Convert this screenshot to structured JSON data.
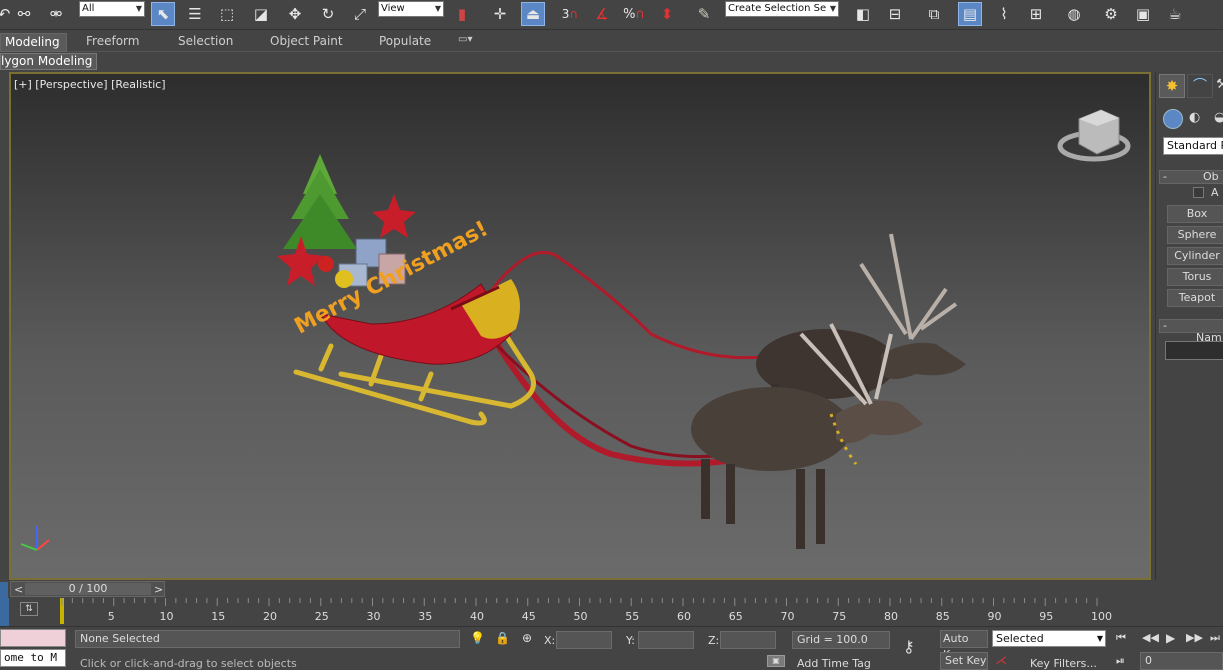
{
  "toolbar": {
    "filter_select": "All",
    "refcoord_select": "View",
    "selection_set_select": "Create Selection Se",
    "snaps": {
      "snap3": "3",
      "percent": "%"
    },
    "icons": [
      "undo-icon",
      "link-icon",
      "select-object-icon",
      "select-by-name-icon",
      "rect-region-icon",
      "window-crossing-icon",
      "move-icon",
      "rotate-icon",
      "scale-icon",
      "pivot-icon",
      "select-manipulate-icon",
      "keyboard-shortcut-icon",
      "snaps-toggle-icon",
      "angle-snap-icon",
      "percent-snap-icon",
      "spinner-snap-icon",
      "edit-named-selection-icon",
      "mirror-icon",
      "align-icon",
      "layer-explorer-icon",
      "scene-explorer-icon",
      "curve-editor-icon",
      "schematic-view-icon",
      "material-editor-icon",
      "render-setup-icon",
      "rendered-frame-icon",
      "render-icon"
    ]
  },
  "ribbon": {
    "tabs": [
      "Modeling",
      "Freeform",
      "Selection",
      "Object Paint",
      "Populate"
    ],
    "active_tab": "Modeling",
    "subtab": "lygon Modeling"
  },
  "viewport": {
    "label": "[+] [Perspective] [Realistic]",
    "border_color": "#7a7033",
    "scene_text": "Merry Christmas!"
  },
  "command_panel": {
    "dropdown": "Standard Pri",
    "object_type_header": "Ob",
    "autogrid_label": "A",
    "buttons": [
      "Box",
      "Sphere",
      "Cylinder",
      "Torus",
      "Teapot"
    ],
    "name_header": "Nam",
    "rollout_toggle": "-"
  },
  "timeslider": {
    "frame": "0 / 100",
    "prev": "<",
    "next": ">"
  },
  "track": {
    "ticks": [
      "5",
      "10",
      "15",
      "20",
      "25",
      "30",
      "35",
      "40",
      "45",
      "50",
      "55",
      "60",
      "65",
      "70",
      "75",
      "80",
      "85",
      "90",
      "95",
      "100"
    ],
    "start": "0",
    "end": "100"
  },
  "status": {
    "maxscript": "ome to M",
    "selection": "None Selected",
    "prompt": "Click or click-and-drag to select objects",
    "x_label": "X:",
    "y_label": "Y:",
    "z_label": "Z:",
    "grid": "Grid = 100.0",
    "add_time_tag": "Add Time Tag",
    "auto_key": "Auto Key",
    "selected": "Selected",
    "set_key": "Set Key",
    "key_filters": "Key Filters...",
    "frame_field": "0"
  },
  "colors": {
    "accent": "#5b87c5",
    "timeline_marker": "#c8b400",
    "sleigh_red": "#c0182a",
    "text_orange": "#f0a020"
  }
}
